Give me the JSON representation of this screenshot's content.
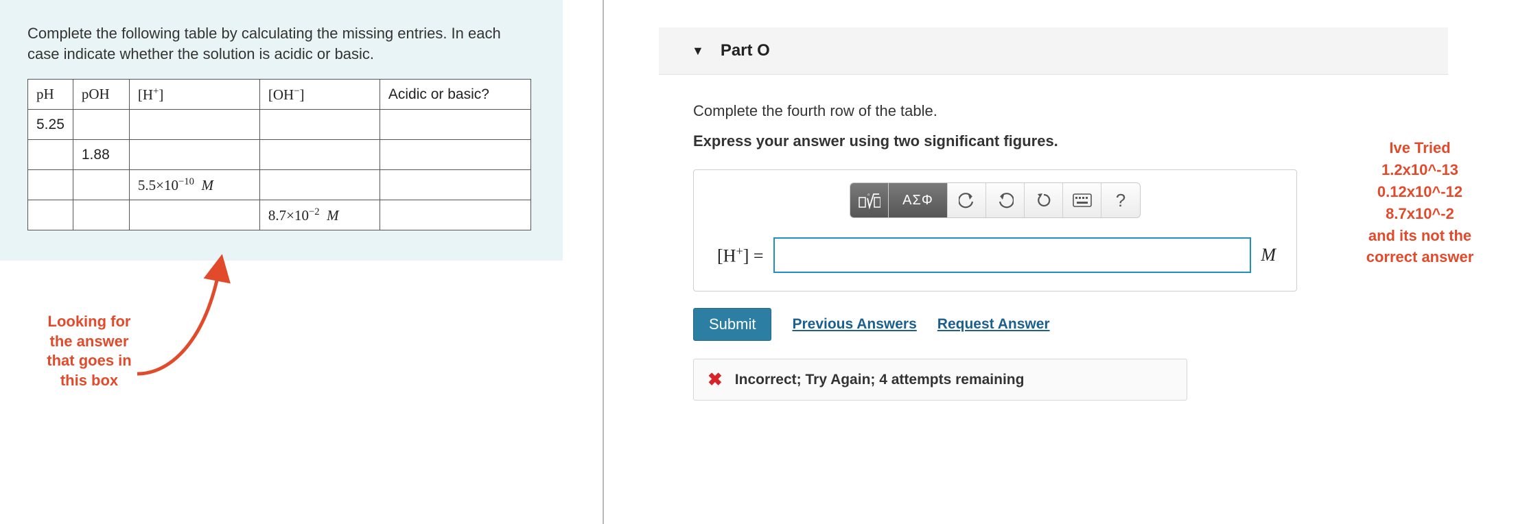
{
  "prompt": "Complete the following table by calculating the missing entries. In each case indicate whether the solution is acidic or basic.",
  "table": {
    "headers": {
      "ph": "pH",
      "poh": "pOH",
      "h": "[H⁺]",
      "oh": "[OH⁻]",
      "ab": "Acidic or basic?"
    },
    "rows": [
      {
        "ph": "5.25",
        "poh": "",
        "h": "",
        "oh": "",
        "ab": ""
      },
      {
        "ph": "",
        "poh": "1.88",
        "h": "",
        "oh": "",
        "ab": ""
      },
      {
        "ph": "",
        "poh": "",
        "h": "5.5×10⁻¹⁰  M",
        "oh": "",
        "ab": ""
      },
      {
        "ph": "",
        "poh": "",
        "h": "",
        "oh": "8.7×10⁻²  M",
        "ab": ""
      }
    ]
  },
  "annot_left": {
    "l1": "Looking for",
    "l2": "the answer",
    "l3": "that goes in",
    "l4": "this box"
  },
  "part": {
    "title": "Part O",
    "instr1": "Complete the fourth row of the table.",
    "instr2": "Express your answer using two significant figures.",
    "toolbar": {
      "templates_icon": "▯√▯",
      "greek": "ΑΣΦ",
      "help": "?"
    },
    "answer_label": "[H⁺] =",
    "answer_value": "",
    "answer_unit": "M",
    "submit": "Submit",
    "prev": "Previous Answers",
    "req": "Request Answer",
    "feedback": "Incorrect; Try Again; 4 attempts remaining"
  },
  "annot_right": {
    "l1": "Ive Tried",
    "l2": "1.2x10^-13",
    "l3": "0.12x10^-12",
    "l4": "8.7x10^-2",
    "l5": "and its not the",
    "l6": "correct answer"
  }
}
